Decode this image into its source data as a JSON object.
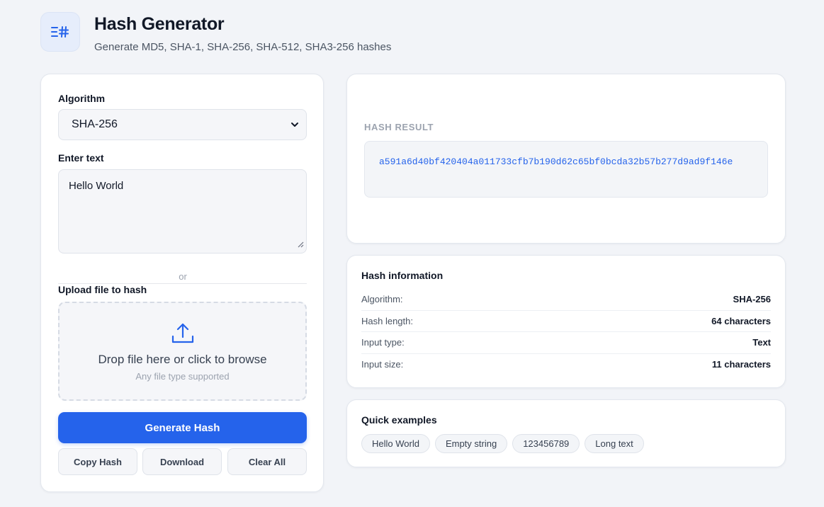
{
  "header": {
    "title": "Hash Generator",
    "subtitle": "Generate MD5, SHA-1, SHA-256, SHA-512, SHA3-256 hashes",
    "icon": "hash-logo-icon"
  },
  "form": {
    "algorithm_label": "Algorithm",
    "algorithm_value": "SHA-256",
    "text_label": "Enter text",
    "text_value": "Hello World",
    "or_text": "or",
    "upload_label": "Upload file to hash",
    "dropzone_title": "Drop file here or click to browse",
    "dropzone_subtitle": "Any file type supported",
    "generate_label": "Generate Hash",
    "copy_label": "Copy Hash",
    "download_label": "Download",
    "clear_label": "Clear All"
  },
  "result": {
    "label": "HASH RESULT",
    "hash": "a591a6d40bf420404a011733cfb7b190d62c65bf0bcda32b57b277d9ad9f146e"
  },
  "info": {
    "title": "Hash information",
    "rows": [
      {
        "key": "Algorithm:",
        "value": "SHA-256"
      },
      {
        "key": "Hash length:",
        "value": "64 characters"
      },
      {
        "key": "Input type:",
        "value": "Text"
      },
      {
        "key": "Input size:",
        "value": "11 characters"
      }
    ]
  },
  "examples": {
    "title": "Quick examples",
    "items": [
      "Hello World",
      "Empty string",
      "123456789",
      "Long text"
    ]
  },
  "colors": {
    "accent": "#2563eb",
    "background": "#f2f4f8"
  }
}
